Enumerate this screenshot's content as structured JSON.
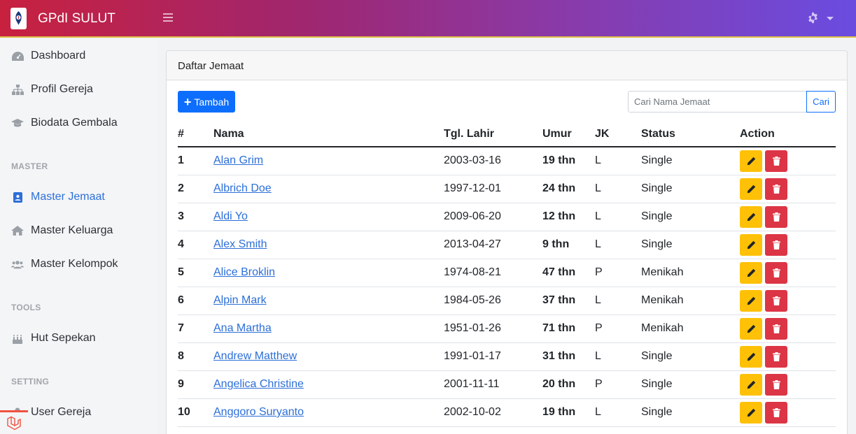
{
  "header": {
    "app_title": "GPdI SULUT",
    "menu_icon": "hamburger-icon",
    "settings_icon": "gear-icon",
    "gradient_start": "#c8213f",
    "gradient_end": "#6a4ce0"
  },
  "sidebar": {
    "items": [
      {
        "label": "Dashboard",
        "icon": "dashboard-icon"
      },
      {
        "label": "Profil Gereja",
        "icon": "sitemap-icon"
      },
      {
        "label": "Biodata Gembala",
        "icon": "graduation-cap-icon"
      }
    ],
    "sections": [
      {
        "heading": "MASTER",
        "items": [
          {
            "label": "Master Jemaat",
            "icon": "address-card-icon",
            "active": true
          },
          {
            "label": "Master Keluarga",
            "icon": "home-icon"
          },
          {
            "label": "Master Kelompok",
            "icon": "users-icon"
          }
        ]
      },
      {
        "heading": "TOOLS",
        "items": [
          {
            "label": "Hut Sepekan",
            "icon": "birthday-cake-icon"
          }
        ]
      },
      {
        "heading": "SETTING",
        "items": [
          {
            "label": "User Gereja",
            "icon": "user-icon"
          }
        ]
      }
    ]
  },
  "card": {
    "title": "Daftar Jemaat",
    "add_button": "Tambah",
    "search_placeholder": "Cari Nama Jemaat",
    "search_button": "Cari"
  },
  "table": {
    "columns": [
      "#",
      "Nama",
      "Tgl. Lahir",
      "Umur",
      "JK",
      "Status",
      "Action"
    ],
    "rows": [
      {
        "no": "1",
        "nama": "Alan Grim",
        "tgl_lahir": "2003-03-16",
        "umur": "19 thn",
        "jk": "L",
        "status": "Single"
      },
      {
        "no": "2",
        "nama": "Albrich Doe",
        "tgl_lahir": "1997-12-01",
        "umur": "24 thn",
        "jk": "L",
        "status": "Single"
      },
      {
        "no": "3",
        "nama": "Aldi Yo",
        "tgl_lahir": "2009-06-20",
        "umur": "12 thn",
        "jk": "L",
        "status": "Single"
      },
      {
        "no": "4",
        "nama": "Alex Smith",
        "tgl_lahir": "2013-04-27",
        "umur": "9 thn",
        "jk": "L",
        "status": "Single"
      },
      {
        "no": "5",
        "nama": "Alice Broklin",
        "tgl_lahir": "1974-08-21",
        "umur": "47 thn",
        "jk": "P",
        "status": "Menikah"
      },
      {
        "no": "6",
        "nama": "Alpin Mark",
        "tgl_lahir": "1984-05-26",
        "umur": "37 thn",
        "jk": "L",
        "status": "Menikah"
      },
      {
        "no": "7",
        "nama": "Ana Martha",
        "tgl_lahir": "1951-01-26",
        "umur": "71 thn",
        "jk": "P",
        "status": "Menikah"
      },
      {
        "no": "8",
        "nama": "Andrew Matthew",
        "tgl_lahir": "1991-01-17",
        "umur": "31 thn",
        "jk": "L",
        "status": "Single"
      },
      {
        "no": "9",
        "nama": "Angelica Christine",
        "tgl_lahir": "2001-11-11",
        "umur": "20 thn",
        "jk": "P",
        "status": "Single"
      },
      {
        "no": "10",
        "nama": "Anggoro Suryanto",
        "tgl_lahir": "2002-10-02",
        "umur": "19 thn",
        "jk": "L",
        "status": "Single"
      }
    ]
  },
  "colors": {
    "primary": "#0d6efd",
    "edit": "#ffc107",
    "delete": "#dc3545",
    "active_link": "#2c6fd8"
  }
}
